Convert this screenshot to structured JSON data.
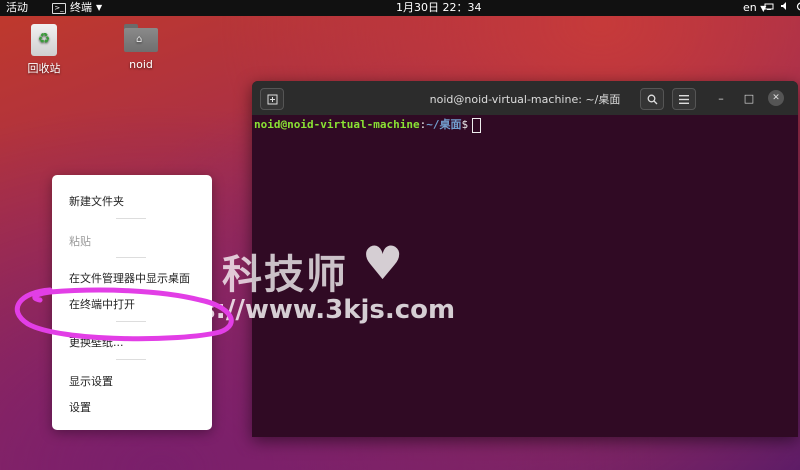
{
  "topbar": {
    "activities": "活动",
    "app_name": "终端",
    "app_menu_arrow": "▼",
    "app_icon": "terminal-icon",
    "clock": "1月30日 22：34",
    "lang": "en",
    "lang_arrow": "▼",
    "system_icons": [
      "network-icon",
      "volume-icon",
      "power-icon"
    ]
  },
  "desktop": {
    "icons": [
      {
        "label": "回收站",
        "icon": "trash-icon"
      },
      {
        "label": "noid",
        "icon": "home-folder-icon"
      }
    ]
  },
  "terminal": {
    "title": "noid@noid-virtual-machine: ~/桌面",
    "buttons": {
      "new_tab": "new-tab-icon",
      "search": "search-icon",
      "menu": "hamburger-menu-icon",
      "minimize": "–",
      "maximize": "□",
      "close": "✕"
    },
    "prompt": {
      "user_host": "noid@noid-virtual-machine",
      "colon": ":",
      "path": "~/桌面",
      "symbol": "$"
    },
    "colors": {
      "background": "#300a24",
      "user": "#8ae234",
      "path": "#729fcf"
    }
  },
  "context_menu": {
    "items": [
      {
        "label": "新建文件夹",
        "disabled": false
      },
      {
        "label": "粘贴",
        "disabled": true
      },
      {
        "label": "在文件管理器中显示桌面",
        "disabled": false
      },
      {
        "label": "在终端中打开",
        "disabled": false
      },
      {
        "label": "更换壁纸...",
        "disabled": false
      },
      {
        "label": "显示设置",
        "disabled": false
      },
      {
        "label": "设置",
        "disabled": false
      }
    ]
  },
  "watermark": {
    "chinese": "科技师",
    "url": "https://www.3kjs.com"
  },
  "annotation": {
    "color": "#e23ee6"
  }
}
